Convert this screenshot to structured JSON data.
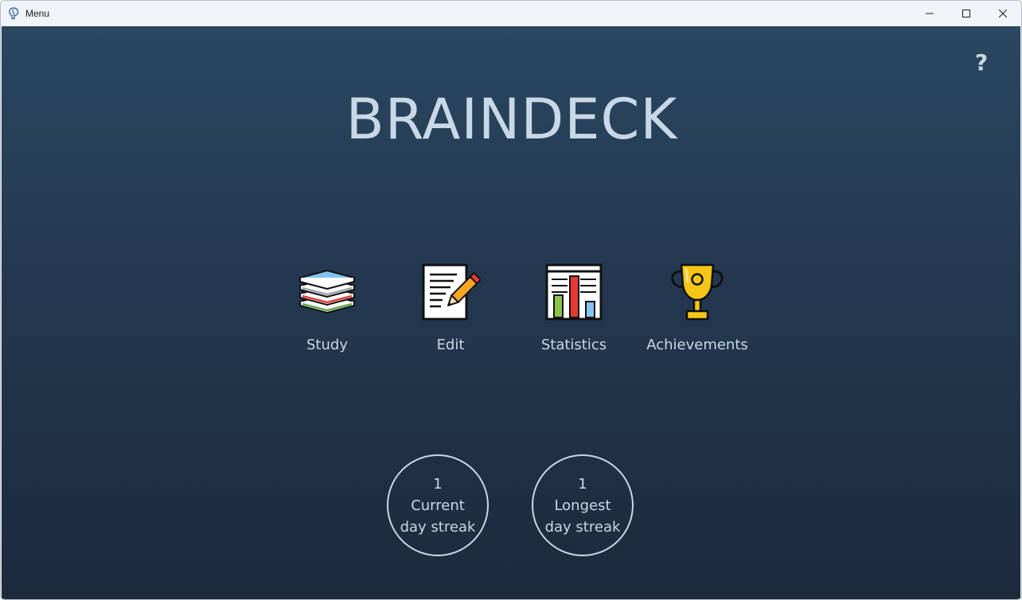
{
  "window": {
    "title": "Menu",
    "app_icon": "brain-icon",
    "controls": [
      "minimize-icon",
      "maximize-icon",
      "close-icon"
    ]
  },
  "header": {
    "help_label": "?",
    "app_title": "BRAINDECK"
  },
  "menu": {
    "items": [
      {
        "label": "Study",
        "icon": "books-icon"
      },
      {
        "label": "Edit",
        "icon": "edit-pencil-icon"
      },
      {
        "label": "Statistics",
        "icon": "bar-chart-icon"
      },
      {
        "label": "Achievements",
        "icon": "trophy-icon"
      }
    ]
  },
  "streaks": {
    "current": {
      "value": "1",
      "line1": "Current",
      "line2": "day streak"
    },
    "longest": {
      "value": "1",
      "line1": "Longest",
      "line2": "day streak"
    }
  },
  "colors": {
    "background_top": "#2a4760",
    "background_bottom": "#1c2a3c",
    "text": "#c9d8e6",
    "trophy": "#f5c518",
    "bar_green": "#8bc34a",
    "bar_red": "#e53935",
    "bar_blue": "#81c4f0"
  }
}
